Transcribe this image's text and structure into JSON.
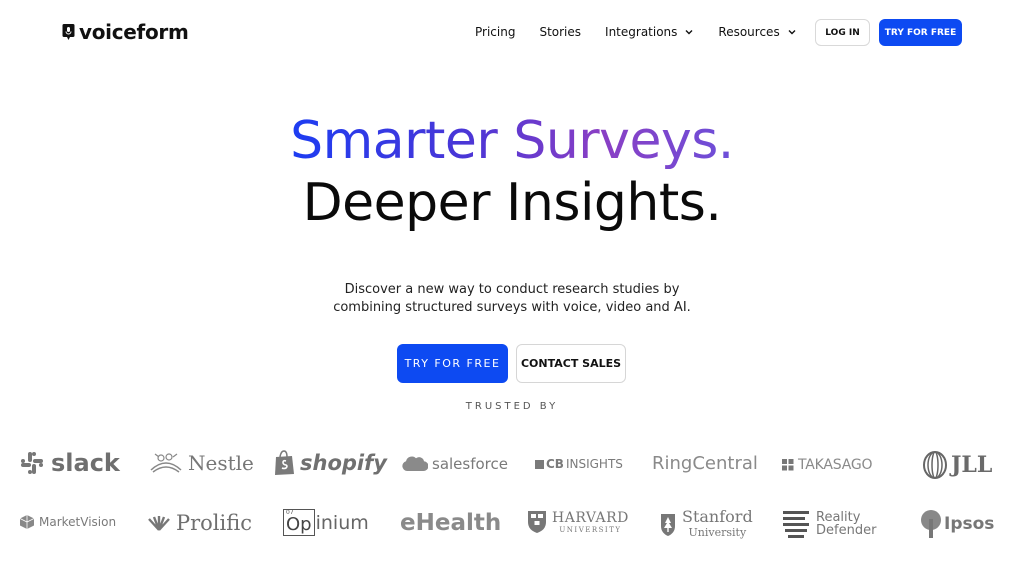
{
  "nav": {
    "brand": "voiceform",
    "links": [
      {
        "label": "Pricing",
        "has_dropdown": false
      },
      {
        "label": "Stories",
        "has_dropdown": false
      },
      {
        "label": "Integrations",
        "has_dropdown": true
      },
      {
        "label": "Resources",
        "has_dropdown": true
      }
    ],
    "login_label": "LOG IN",
    "try_label": "TRY FOR FREE"
  },
  "hero": {
    "headline_line1": "Smarter Surveys.",
    "headline_line2": "Deeper Insights.",
    "subtext_line1": "Discover a new way to conduct research studies by",
    "subtext_line2": "combining structured surveys with voice, video and AI.",
    "primary_cta": "TRY FOR FREE",
    "secondary_cta": "CONTACT SALES",
    "trusted_label": "TRUSTED BY"
  },
  "logos": {
    "slack": "slack",
    "nestle": "Nestle",
    "shopify": "shopify",
    "salesforce": "salesforce",
    "cbinsights_cb": "CB",
    "cbinsights_rest": "INSIGHTS",
    "ringcentral": "RingCentral",
    "takasago": "TAKASAGO",
    "jll": "JLL",
    "marketvision": "MarketVision",
    "prolific": "Prolific",
    "opinium_small": "07",
    "opinium_op": "Op",
    "opinium_rest": "inium",
    "ehealth": "eHealth",
    "harvard_name": "HARVARD",
    "harvard_sub": "UNIVERSITY",
    "stanford_name": "Stanford",
    "stanford_sub": "University",
    "reality_line1": "Reality",
    "reality_line2": "Defender",
    "ipsos": "Ipsos"
  },
  "colors": {
    "primary": "#0d4af2",
    "gradient_start": "#1d3df2",
    "gradient_end": "#8a3fc4",
    "logo_gray": "#7a7a7a"
  }
}
